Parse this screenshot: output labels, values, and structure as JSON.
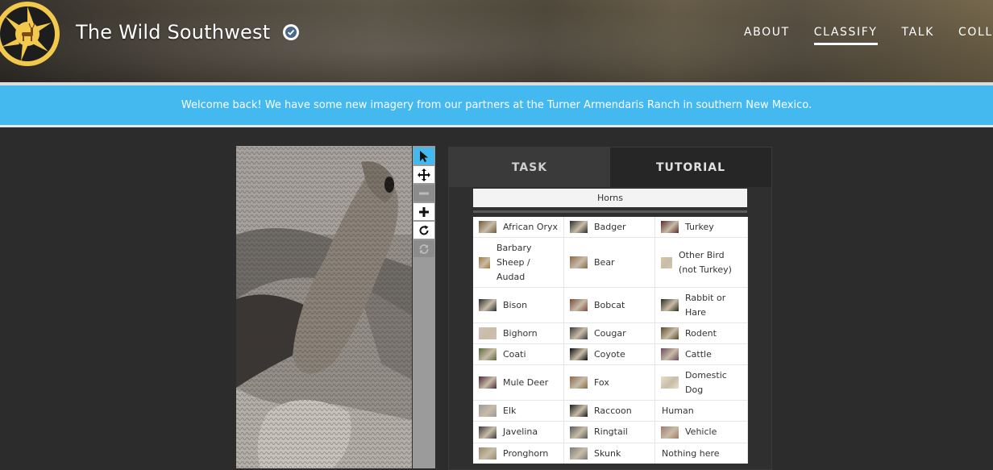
{
  "header": {
    "title": "The Wild Southwest",
    "nav": [
      "ABOUT",
      "CLASSIFY",
      "TALK",
      "COLLE"
    ],
    "active_nav": "CLASSIFY"
  },
  "banner": {
    "text": "Welcome back! We have some new imagery from our partners at the Turner Armendaris Ranch in southern New Mexico."
  },
  "toolbar": {
    "tools": [
      "pointer-icon",
      "move-icon",
      "zoom-out-icon",
      "zoom-in-icon",
      "rotate-icon",
      "reset-icon"
    ]
  },
  "panel": {
    "tabs": [
      "TASK",
      "TUTORIAL"
    ],
    "filter_label": "Horns",
    "choices": [
      {
        "label": "African Oryx",
        "thumb": "#6b5a3a"
      },
      {
        "label": "Badger",
        "thumb": "#2a2a2a"
      },
      {
        "label": "Turkey",
        "thumb": "#5a2a2a"
      },
      {
        "label": "Barbary Sheep / Audad",
        "thumb": "#a07a3a"
      },
      {
        "label": "Bear",
        "thumb": "#8a6a4a"
      },
      {
        "label": "Other Bird (not Turkey)",
        "thumb": "#d8c8a8"
      },
      {
        "label": "Bison",
        "thumb": "#2a2a2a"
      },
      {
        "label": "Bobcat",
        "thumb": "#7a4a3a"
      },
      {
        "label": "Rabbit or Hare",
        "thumb": "#2a2a1a"
      },
      {
        "label": "Bighorn",
        "thumb": "#d0c0b8"
      },
      {
        "label": "Cougar",
        "thumb": "#3a3a3a"
      },
      {
        "label": "Rodent",
        "thumb": "#5a4a2a"
      },
      {
        "label": "Coati",
        "thumb": "#5a6a3a"
      },
      {
        "label": "Coyote",
        "thumb": "#0a0a0a"
      },
      {
        "label": "Cattle",
        "thumb": "#6a4a5a"
      },
      {
        "label": "Mule Deer",
        "thumb": "#4a2a3a"
      },
      {
        "label": "Fox",
        "thumb": "#8a6a4a"
      },
      {
        "label": "Domestic Dog",
        "thumb": "#e8e0c8"
      },
      {
        "label": "Elk",
        "thumb": "#9a9a9a"
      },
      {
        "label": "Raccoon",
        "thumb": "#1a1a1a"
      },
      {
        "label": "Human",
        "thumb": ""
      },
      {
        "label": "Javelina",
        "thumb": "#3a3a3a"
      },
      {
        "label": "Ringtail",
        "thumb": "#5a5a5a"
      },
      {
        "label": "Vehicle",
        "thumb": "#a07a6a"
      },
      {
        "label": "Pronghorn",
        "thumb": "#9a8a6a"
      },
      {
        "label": "Skunk",
        "thumb": "#7a7a7a"
      },
      {
        "label": "Nothing here",
        "thumb": ""
      }
    ]
  }
}
